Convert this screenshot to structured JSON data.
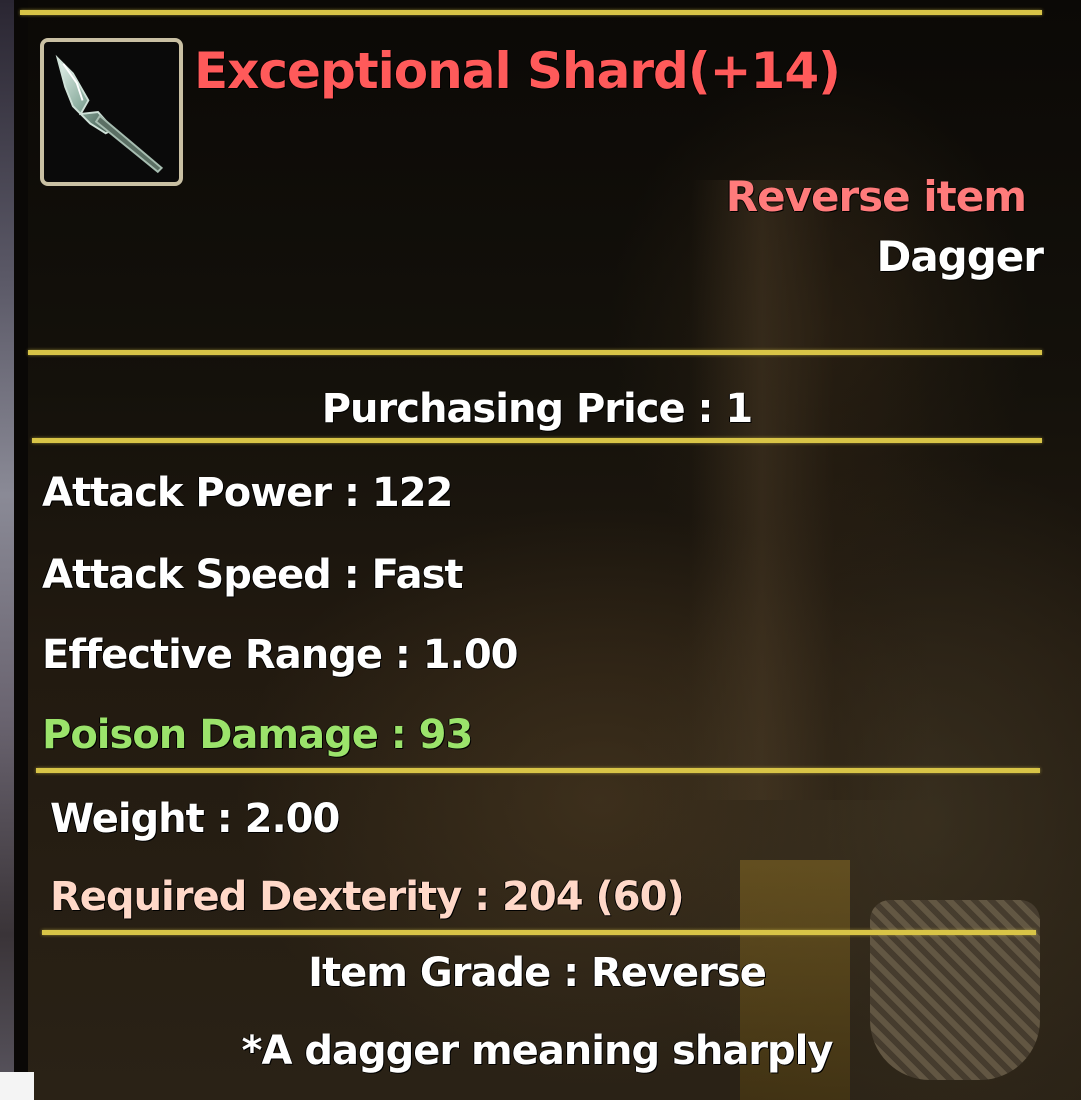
{
  "item": {
    "name": "Exceptional Shard(+14)",
    "type_label": "Reverse item",
    "class_label": "Dagger",
    "icon": "dagger-icon"
  },
  "price": {
    "text": "Purchasing Price : 1"
  },
  "stats": {
    "attack_power": "Attack Power : 122",
    "attack_speed": "Attack Speed : Fast",
    "effective_range": "Effective Range : 1.00",
    "poison_damage": "Poison Damage : 93"
  },
  "requirements": {
    "weight": "Weight : 2.00",
    "required_dexterity": "Required Dexterity : 204 (60)"
  },
  "footer": {
    "grade": "Item Grade : Reverse",
    "description": "*A dagger meaning sharply"
  },
  "colors": {
    "name": "#ff5a5a",
    "type": "#ff7b7b",
    "poison": "#9be36b",
    "rule": "#d8c447",
    "required": "#ffd8c8"
  }
}
